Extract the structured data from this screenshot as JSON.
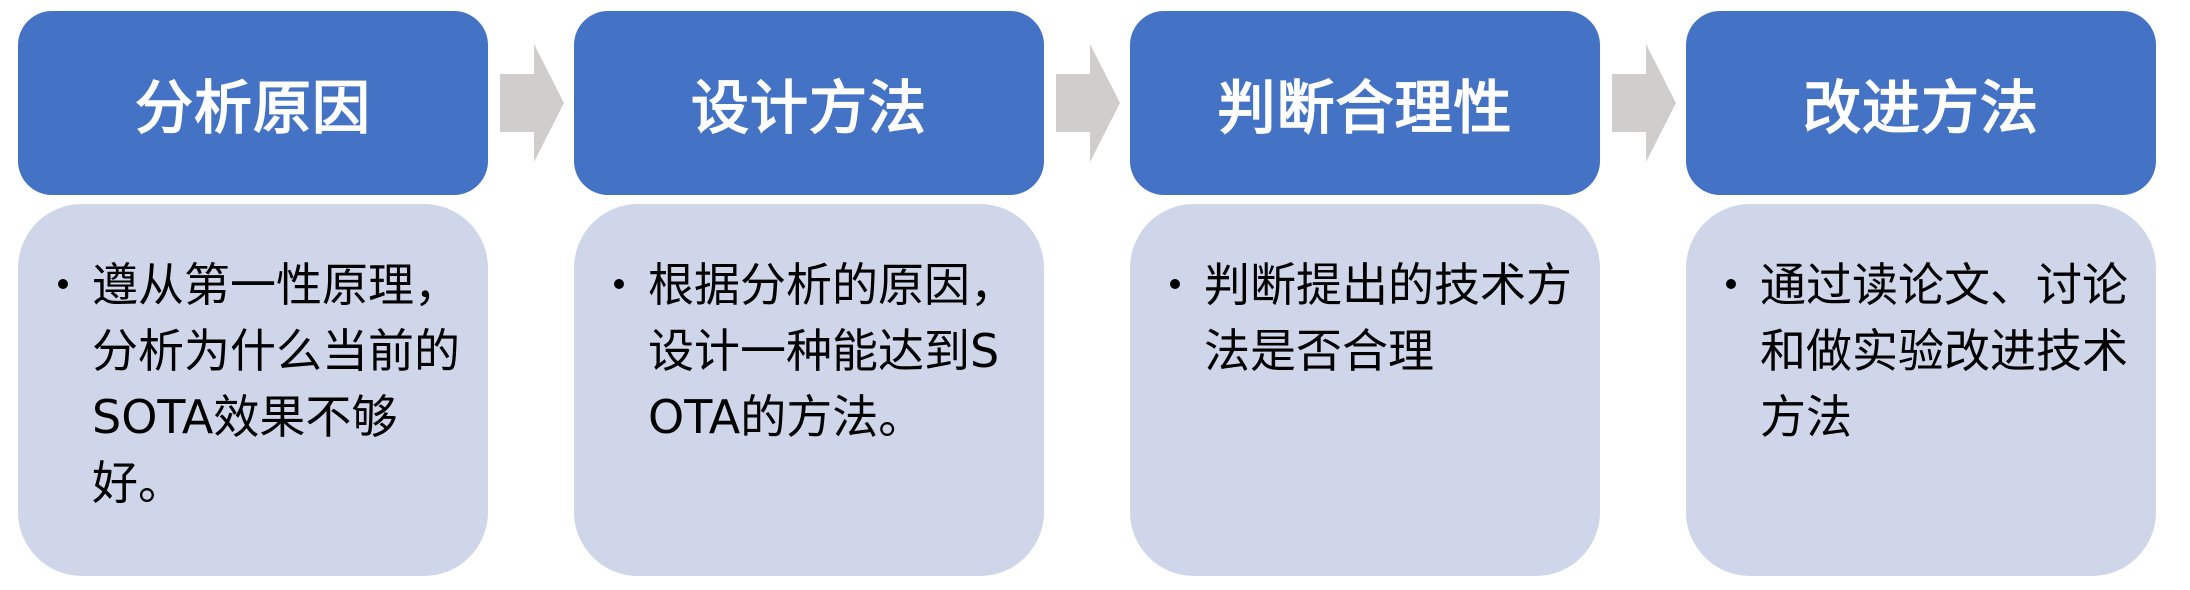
{
  "steps": [
    {
      "title": "分析原因",
      "text": "遵从第一性原理，分析为什么当前的SOTA效果不够好。"
    },
    {
      "title": "设计方法",
      "text": "根据分析的原因，设计一种能达到SOTA的方法。"
    },
    {
      "title": "判断合理性",
      "text": "判断提出的技术方法是否合理"
    },
    {
      "title": "改进方法",
      "text": "通过读论文、讨论和做实验改进技术方法"
    }
  ],
  "colors": {
    "header": "#4472c4",
    "body": "#cfd6ea",
    "arrow": "#d0cecd"
  }
}
